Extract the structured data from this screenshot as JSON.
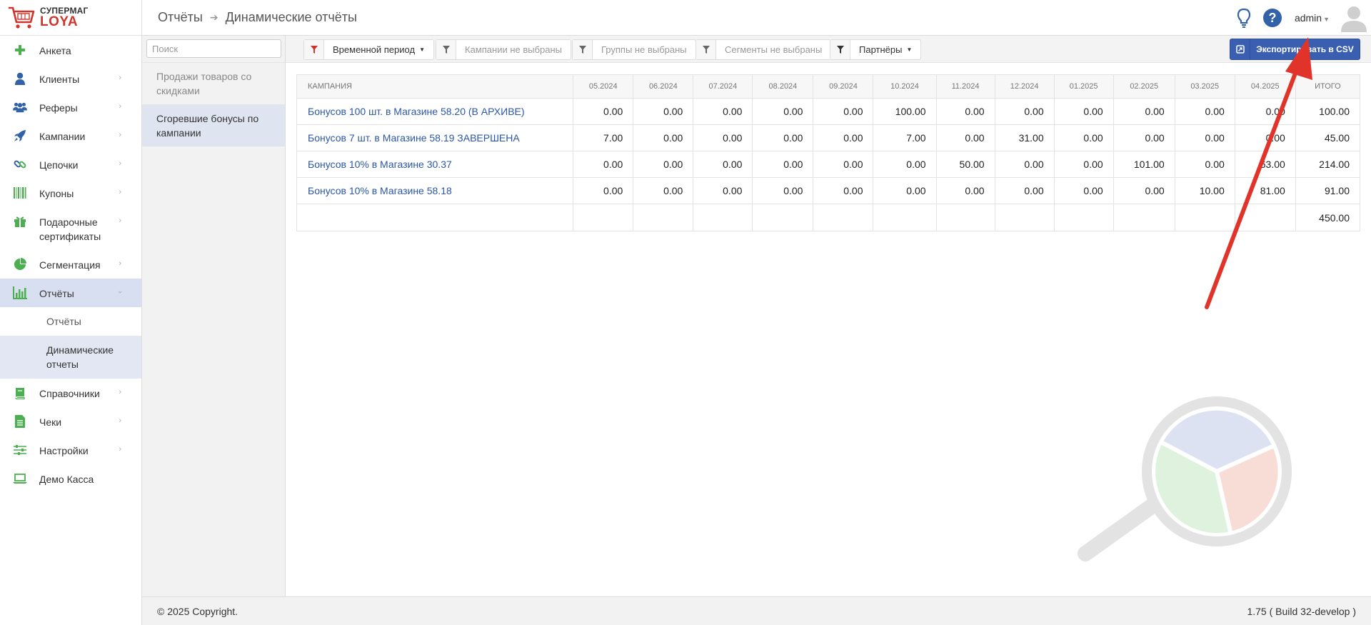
{
  "logo": {
    "line1": "СУПЕРМАГ",
    "line2": "LOYA",
    "icon": "cart-icon"
  },
  "sidebar": {
    "items": [
      {
        "label": "Анкета",
        "icon": "plus-icon",
        "chevron": false
      },
      {
        "label": "Клиенты",
        "icon": "user-icon",
        "chevron": true
      },
      {
        "label": "Реферы",
        "icon": "users-icon",
        "chevron": true
      },
      {
        "label": "Кампании",
        "icon": "rocket-icon",
        "chevron": true
      },
      {
        "label": "Цепочки",
        "icon": "chain-icon",
        "chevron": true
      },
      {
        "label": "Купоны",
        "icon": "barcode-icon",
        "chevron": true
      },
      {
        "label": "Подарочные сертификаты",
        "icon": "gift-icon",
        "chevron": true
      },
      {
        "label": "Сегментация",
        "icon": "pie-icon",
        "chevron": true
      },
      {
        "label": "Отчёты",
        "icon": "bar-chart-icon",
        "chevron": true,
        "expanded": true
      },
      {
        "label": "Справочники",
        "icon": "book-icon",
        "chevron": true
      },
      {
        "label": "Чеки",
        "icon": "receipt-icon",
        "chevron": true
      },
      {
        "label": "Настройки",
        "icon": "sliders-icon",
        "chevron": true
      },
      {
        "label": "Демо Касса",
        "icon": "laptop-icon",
        "chevron": false
      }
    ],
    "sub_items": [
      {
        "label": "Отчёты"
      },
      {
        "label": "Динамические отчеты",
        "active": true
      }
    ]
  },
  "header": {
    "breadcrumb": [
      "Отчёты",
      "Динамические отчёты"
    ],
    "user": "admin",
    "help": "?"
  },
  "reports": {
    "search_placeholder": "Поиск",
    "items": [
      {
        "label": "Продажи товаров со скидками"
      },
      {
        "label": "Сгоревшие бонусы по кампании",
        "active": true
      }
    ]
  },
  "toolbar": {
    "filters": [
      {
        "label": "Временной период",
        "dropdown": true,
        "accent": "#d0342c"
      },
      {
        "label": "Кампании не выбраны"
      },
      {
        "label": "Группы не выбраны"
      },
      {
        "label": "Сегменты не выбраны"
      },
      {
        "label": "Партнёры",
        "dropdown": true
      }
    ],
    "export_label": "Экспортировать в CSV"
  },
  "table": {
    "headers": [
      "КАМПАНИЯ",
      "05.2024",
      "06.2024",
      "07.2024",
      "08.2024",
      "09.2024",
      "10.2024",
      "11.2024",
      "12.2024",
      "01.2025",
      "02.2025",
      "03.2025",
      "04.2025",
      "ИТОГО"
    ],
    "rows": [
      {
        "campaign": "Бонусов 100 шт. в Магазине 58.20 (В АРХИВЕ)",
        "values": [
          "0.00",
          "0.00",
          "0.00",
          "0.00",
          "0.00",
          "100.00",
          "0.00",
          "0.00",
          "0.00",
          "0.00",
          "0.00",
          "0.00",
          "100.00"
        ]
      },
      {
        "campaign": "Бонусов 7 шт. в Магазине 58.19 ЗАВЕРШЕНА",
        "values": [
          "7.00",
          "0.00",
          "0.00",
          "0.00",
          "0.00",
          "7.00",
          "0.00",
          "31.00",
          "0.00",
          "0.00",
          "0.00",
          "0.00",
          "45.00"
        ]
      },
      {
        "campaign": "Бонусов 10% в Магазине 30.37",
        "values": [
          "0.00",
          "0.00",
          "0.00",
          "0.00",
          "0.00",
          "0.00",
          "50.00",
          "0.00",
          "0.00",
          "101.00",
          "0.00",
          "63.00",
          "214.00"
        ]
      },
      {
        "campaign": "Бонусов 10% в Магазине 58.18",
        "values": [
          "0.00",
          "0.00",
          "0.00",
          "0.00",
          "0.00",
          "0.00",
          "0.00",
          "0.00",
          "0.00",
          "0.00",
          "10.00",
          "81.00",
          "91.00"
        ]
      }
    ],
    "total": "450.00"
  },
  "footer": {
    "copyright": "© 2025 Copyright.",
    "version": "1.75 ( Build 32-develop )"
  },
  "colors": {
    "accent": "#3b5fb0",
    "link": "#2c57a8",
    "brand_red": "#d0342c",
    "icon_green": "#4caf50",
    "icon_blue": "#3262a8",
    "annotation_red": "#e0342b"
  }
}
